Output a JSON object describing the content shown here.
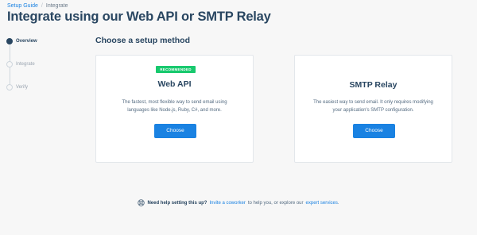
{
  "breadcrumb": {
    "parent": "Setup Guide",
    "separator": "/",
    "current": "Integrate"
  },
  "page_title": "Integrate using our Web API or SMTP Relay",
  "steps": [
    {
      "label": "Overview",
      "state": "active"
    },
    {
      "label": "Integrate",
      "state": "pending"
    },
    {
      "label": "Verify",
      "state": "pending"
    }
  ],
  "section_title": "Choose a setup method",
  "cards": {
    "web_api": {
      "badge": "RECOMMENDED",
      "title": "Web API",
      "description": "The fastest, most flexible way to send email using languages like Node.js, Ruby, C#, and more.",
      "button": "Choose"
    },
    "smtp": {
      "title": "SMTP Relay",
      "description": "The easiest way to send email. It only requires modifying your application's SMTP configuration.",
      "button": "Choose"
    }
  },
  "help": {
    "icon": "lifebuoy-icon",
    "lead": "Need help setting this up?",
    "invite_link": "Invite a coworker",
    "middle": "to help you, or explore our",
    "services_link": "expert services",
    "end": "."
  },
  "colors": {
    "accent": "#1a82e2",
    "badge": "#18c96e",
    "text": "#294661"
  }
}
